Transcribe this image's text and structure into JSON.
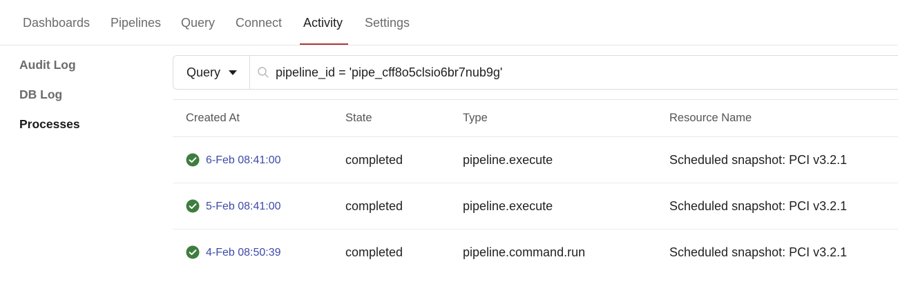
{
  "topnav": {
    "tabs": [
      {
        "label": "Dashboards"
      },
      {
        "label": "Pipelines"
      },
      {
        "label": "Query"
      },
      {
        "label": "Connect"
      },
      {
        "label": "Activity"
      },
      {
        "label": "Settings"
      }
    ],
    "active_tab": "Activity",
    "accent_color": "#b0353b"
  },
  "sidebar": {
    "items": [
      {
        "label": "Audit Log"
      },
      {
        "label": "DB Log"
      },
      {
        "label": "Processes"
      }
    ],
    "active_item": "Processes"
  },
  "search": {
    "mode_label": "Query",
    "value": "pipeline_id = 'pipe_cff8o5clsio6br7nub9g'"
  },
  "table": {
    "columns": [
      "Created At",
      "State",
      "Type",
      "Resource Name"
    ],
    "rows": [
      {
        "created_at": "6-Feb 08:41:00",
        "state": "completed",
        "type": "pipeline.execute",
        "resource_name": "Scheduled snapshot: PCI v3.2.1",
        "status_icon": "check-circle-icon"
      },
      {
        "created_at": "5-Feb 08:41:00",
        "state": "completed",
        "type": "pipeline.execute",
        "resource_name": "Scheduled snapshot: PCI v3.2.1",
        "status_icon": "check-circle-icon"
      },
      {
        "created_at": "4-Feb 08:50:39",
        "state": "completed",
        "type": "pipeline.command.run",
        "resource_name": "Scheduled snapshot: PCI v3.2.1",
        "status_icon": "check-circle-icon"
      }
    ],
    "status_color": "#3f7d3f",
    "link_color": "#3d4aa8"
  }
}
